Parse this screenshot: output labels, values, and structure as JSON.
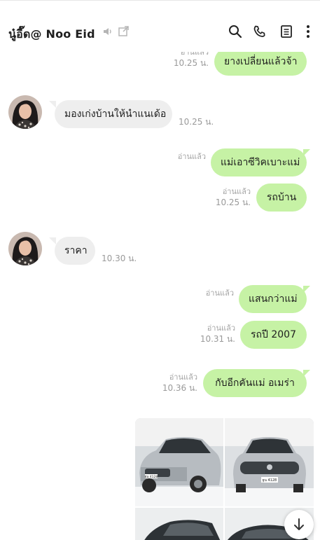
{
  "header": {
    "title": "นู๋อี๊ด@  Noo Eid"
  },
  "messages": [
    {
      "text": "ยางเปลี่ยนแล้วจ้า",
      "read": "อ่านแล้ว",
      "time": "10.25 น."
    },
    {
      "text": "มองเก่งบ้านให้นำแนเด้อ",
      "time": "10.25 น."
    },
    {
      "text": "แม่เอาซีวิคเบาะแม่",
      "read": "อ่านแล้ว"
    },
    {
      "text": "รถบ้าน",
      "read": "อ่านแล้ว",
      "time": "10.25 น."
    },
    {
      "text": "ราคา",
      "time": "10.30 น."
    },
    {
      "text": "แสนกว่าแม่",
      "read": "อ่านแล้ว"
    },
    {
      "text": "รถปี 2007",
      "read": "อ่านแล้ว",
      "time": "10.31 น."
    },
    {
      "text": "กับอีกคันแม่  อเมร่า",
      "read": "อ่านแล้ว",
      "time": "10.36 น."
    }
  ],
  "plates": [
    "ฐน 4128",
    "ฐน 4128"
  ]
}
